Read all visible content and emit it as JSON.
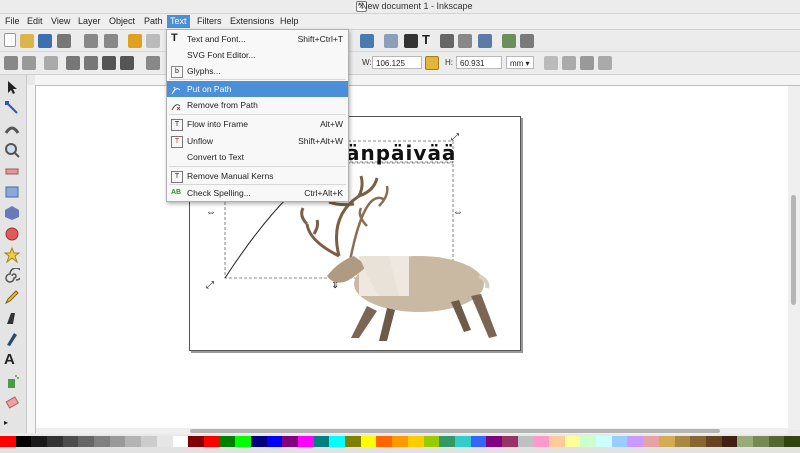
{
  "window": {
    "title": "*New document 1 - Inkscape",
    "app_badge": "X"
  },
  "menubar": {
    "items": [
      "File",
      "Edit",
      "View",
      "Layer",
      "Object",
      "Path",
      "Text",
      "Filters",
      "Extensions",
      "Help"
    ],
    "active": "Text"
  },
  "text_menu": {
    "items": [
      {
        "label": "Text and Font...",
        "shortcut": "Shift+Ctrl+T",
        "icon": "text-font-icon"
      },
      {
        "label": "SVG Font Editor...",
        "shortcut": "",
        "icon": ""
      },
      {
        "label": "Glyphs...",
        "shortcut": "",
        "icon": "glyphs-icon"
      },
      {
        "label": "Put on Path",
        "shortcut": "",
        "icon": "put-on-path-icon",
        "highlighted": true
      },
      {
        "label": "Remove from Path",
        "shortcut": "",
        "icon": "remove-from-path-icon"
      },
      {
        "label": "Flow into Frame",
        "shortcut": "Alt+W",
        "icon": "flow-into-frame-icon"
      },
      {
        "label": "Unflow",
        "shortcut": "Shift+Alt+W",
        "icon": "unflow-icon"
      },
      {
        "label": "Convert to Text",
        "shortcut": "",
        "icon": ""
      },
      {
        "label": "Remove Manual Kerns",
        "shortcut": "",
        "icon": "remove-kerns-icon"
      },
      {
        "label": "Check Spelling...",
        "shortcut": "Ctrl+Alt+K",
        "icon": "spellcheck-icon"
      }
    ]
  },
  "toolcontrols": {
    "w_label": "W:",
    "w_value": "106.125",
    "h_label": "H:",
    "h_value": "60.931",
    "unit": "mm"
  },
  "canvas": {
    "text_on_path": "änpäivää"
  },
  "colors": {
    "accent": "#4a8fd8"
  }
}
